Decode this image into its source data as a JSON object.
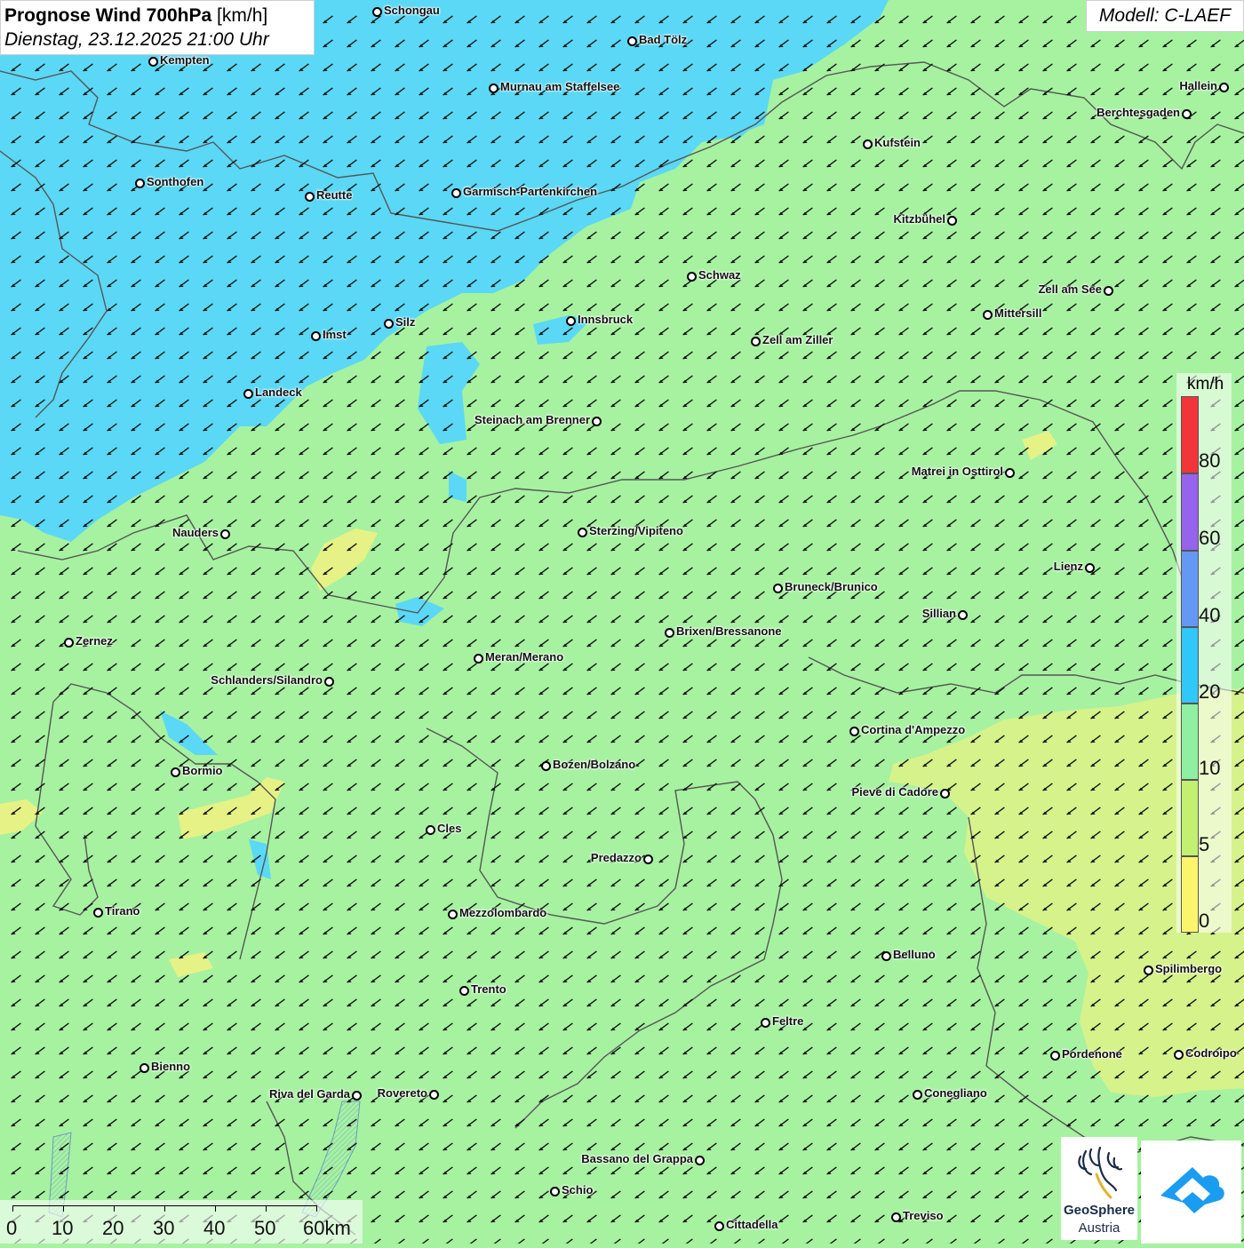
{
  "title": {
    "bold": "Prognose Wind 700hPa",
    "unit": "[km/h]",
    "date": "Dienstag, 23.12.2025 21:00 Uhr"
  },
  "model_label": "Modell: C-LAEF",
  "legend": {
    "unit": "km/h",
    "labels": [
      "80",
      "60",
      "40",
      "20",
      "10",
      "5",
      "0"
    ],
    "colors": {
      "80": "#f2353a",
      "60": "#9563ec",
      "40": "#6597f5",
      "20": "#30c8f8",
      "10": "#8ef0a0",
      "5": "#c2f070",
      "0": "#fbf56d"
    }
  },
  "scale": {
    "labels": [
      "0",
      "10",
      "20",
      "30",
      "40",
      "50",
      "60km"
    ]
  },
  "logo": {
    "name": "GeoSphere",
    "country": "Austria"
  },
  "cities": [
    "Schongau",
    "Bad Tölz",
    "Kempten",
    "Murnau am Staffelsee",
    "Hallein",
    "Berchtesgaden",
    "Kufstein",
    "Sonthofen",
    "Reutte",
    "Garmisch-Partenkirchen",
    "Kitzbühel",
    "Schwaz",
    "Zell am See",
    "Mittersill",
    "Innsbruck",
    "Silz",
    "Imst",
    "Zell am Ziller",
    "Landeck",
    "Steinach am Brenner",
    "Matrei in Osttirol",
    "Nauders",
    "Sterzing/Vipiteno",
    "Lienz",
    "Bruneck/Brunico",
    "Sillian",
    "Brixen/Bressanone",
    "Zernez",
    "Meran/Merano",
    "Schlanders/Silandro",
    "Cortina d'Ampezzo",
    "Bozen/Bolzano",
    "Bormio",
    "Pieve di Cadore",
    "Cles",
    "Predazzo",
    "Tirano",
    "Mezzolombardo",
    "Belluno",
    "Spilimbergo",
    "Trento",
    "Feltre",
    "Pordenone",
    "Codroipo",
    "Bienno",
    "Riva del Garda",
    "Rovereto",
    "Conegliano",
    "Bassano del Grappa",
    "Schio",
    "Treviso",
    "Cittadella"
  ],
  "map_colors": {
    "calm_10_20": "#a6f2a0",
    "band_20_40": "#5ad8f6",
    "band_5_10": "#d6f28a"
  },
  "wind_direction": "north-east to south-west"
}
